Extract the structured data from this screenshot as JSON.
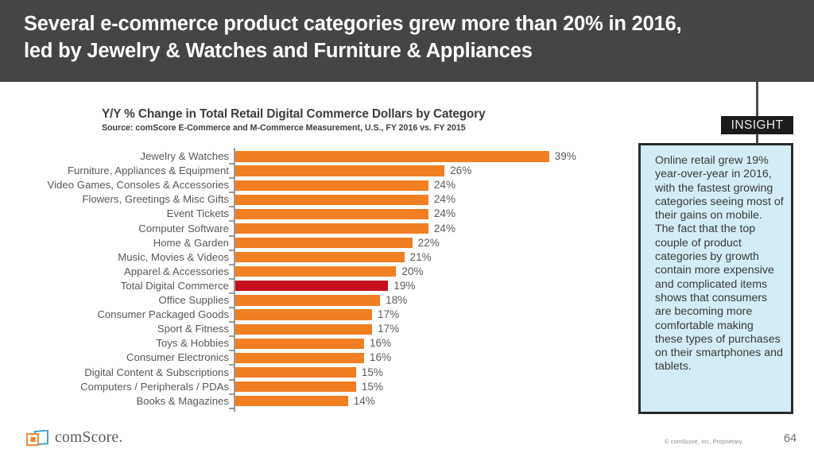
{
  "header": {
    "title_line1": "Several e-commerce product categories grew more than 20% in 2016,",
    "title_line2": "led by Jewelry & Watches and Furniture & Appliances",
    "background_color": "#454545"
  },
  "insight": {
    "tag_label": "INSIGHT",
    "body": "Online retail grew 19% year-over-year in 2016, with the fastest growing categories seeing most of their gains on mobile. The fact that the top couple of product categories by growth contain more expensive and complicated items shows that consumers are becoming more comfortable making these types of purchases on their smartphones and tablets.",
    "background_color": "#d4ecf5",
    "border_color": "#2b2b2b"
  },
  "footer": {
    "logo_text": "comScore.",
    "copyright": "© comScore, Inc. Proprietary.",
    "page_number": "64"
  },
  "chart_data": {
    "type": "bar",
    "orientation": "horizontal",
    "title": "Y/Y % Change in Total Retail Digital Commerce Dollars by Category",
    "subtitle": "Source: comScore E-Commerce and M-Commerce Measurement, U.S., FY 2016 vs. FY 2015",
    "xlabel": "",
    "ylabel": "",
    "xlim": [
      0,
      39
    ],
    "grid": false,
    "legend": false,
    "value_suffix": "%",
    "bar_color": "#f07f22",
    "highlight_color": "#c5111e",
    "highlight_category": "Total Digital Commerce",
    "categories": [
      "Jewelry & Watches",
      "Furniture, Appliances & Equipment",
      "Video Games, Consoles & Accessories",
      "Flowers, Greetings & Misc Gifts",
      "Event Tickets",
      "Computer Software",
      "Home & Garden",
      "Music, Movies & Videos",
      "Apparel & Accessories",
      "Total Digital Commerce",
      "Office Supplies",
      "Consumer Packaged Goods",
      "Sport & Fitness",
      "Toys & Hobbies",
      "Consumer Electronics",
      "Digital Content & Subscriptions",
      "Computers / Peripherals / PDAs",
      "Books & Magazines"
    ],
    "values": [
      39,
      26,
      24,
      24,
      24,
      24,
      22,
      21,
      20,
      19,
      18,
      17,
      17,
      16,
      16,
      15,
      15,
      14
    ],
    "value_labels": [
      "39%",
      "26%",
      "24%",
      "24%",
      "24%",
      "24%",
      "22%",
      "21%",
      "20%",
      "19%",
      "18%",
      "17%",
      "17%",
      "16%",
      "16%",
      "15%",
      "15%",
      "14%"
    ]
  }
}
